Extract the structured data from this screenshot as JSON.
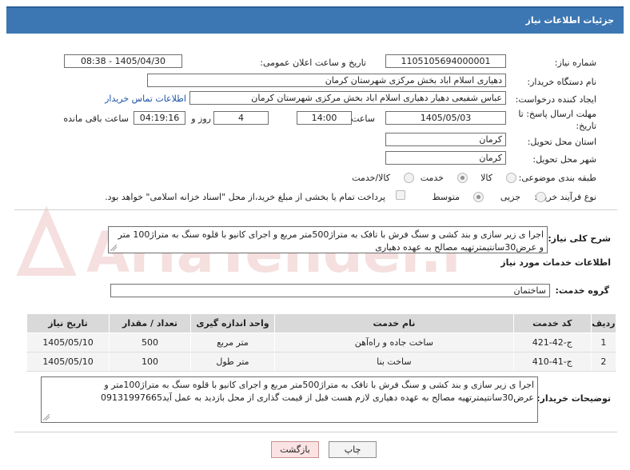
{
  "header": {
    "title": "جزئیات اطلاعات نیاز"
  },
  "form": {
    "need_number": {
      "label": "شماره نیاز:",
      "value": "1105105694000001"
    },
    "announce_datetime": {
      "label": "تاریخ و ساعت اعلان عمومی:",
      "value": "1405/04/30 - 08:38"
    },
    "buyer_org": {
      "label": "نام دستگاه خریدار:",
      "value": "دهیاری اسلام اباد بخش مرکزی شهرستان کرمان"
    },
    "requester": {
      "label": "ایجاد کننده درخواست:",
      "value": "عباس شفیعی دهیار دهیاری اسلام اباد بخش مرکزی شهرستان کرمان",
      "contact_link": "اطلاعات تماس خریدار"
    },
    "deadline": {
      "label_line1": "مهلت ارسال پاسخ: تا",
      "label_line2": "تاریخ:",
      "date": "1405/05/03",
      "time_label": "ساعت",
      "time": "14:00",
      "days": "4",
      "days_label": "روز و",
      "remaining": "04:19:16",
      "remaining_label": "ساعت باقی مانده"
    },
    "province": {
      "label": "استان محل تحویل:",
      "value": "کرمان"
    },
    "city": {
      "label": "شهر محل تحویل:",
      "value": "کرمان"
    },
    "category": {
      "label": "طبقه بندی موضوعی:",
      "options": [
        "کالا",
        "خدمت",
        "کالا/خدمت"
      ],
      "selected": "خدمت"
    },
    "purchase_type": {
      "label": "نوع فرآیند خرید :",
      "options": [
        "جزیی",
        "متوسط"
      ],
      "selected": "متوسط",
      "note": "پرداخت تمام یا بخشی از مبلغ خرید،از محل \"اسناد خزانه اسلامی\" خواهد بود."
    }
  },
  "description": {
    "label": "شرح کلی نیاز:",
    "text": "اجرا ی زیر سازی و بند کشی و سنگ فرش با تافک به متراژ500متر مربع و اجرای کانیو با قلوه سنگ به متراژ100 متر و عرض30سانتیمترتهیه مصالح به عهده دهیاری"
  },
  "services": {
    "section_title": "اطلاعات خدمات مورد نیاز",
    "group_label": "گروه خدمت:",
    "group_value": "ساختمان",
    "columns": [
      "ردیف",
      "کد خدمت",
      "نام خدمت",
      "واحد اندازه گیری",
      "تعداد / مقدار",
      "تاریخ نیاز"
    ],
    "rows": [
      {
        "row": "1",
        "code": "ج-42-421",
        "name": "ساخت جاده و راه‌آهن",
        "unit": "متر مربع",
        "qty": "500",
        "date": "1405/05/10"
      },
      {
        "row": "2",
        "code": "ج-41-410",
        "name": "ساخت بنا",
        "unit": "متر طول",
        "qty": "100",
        "date": "1405/05/10"
      }
    ]
  },
  "buyer_notes": {
    "label": "توضیحات خریدار:",
    "text": "اجرا ی زیر سازی و بند کشی و سنگ فرش با تافک به متراژ500متر مربع و اجرای کانیو با قلوه سنگ به متراژ100متر و عرض30سانتیمترتهیه مصالح به عهده دهیاری لازم هست قبل از قیمت گذاری از محل بازدید به عمل آید09131997665"
  },
  "buttons": {
    "back": "بازگشت",
    "print": "چاپ"
  },
  "watermark": {
    "text": "AriaTender.net"
  }
}
